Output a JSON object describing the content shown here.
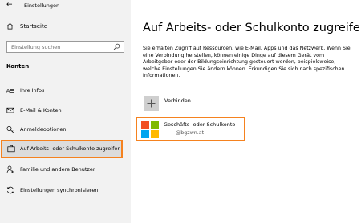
{
  "app": {
    "title": "Einstellungen",
    "back_icon": "arrow-left-icon"
  },
  "sidebar": {
    "home": {
      "label": "Startseite",
      "icon": "home-icon"
    },
    "search": {
      "placeholder": "Einstellung suchen",
      "icon": "search-icon"
    },
    "section_heading": "Konten",
    "items": [
      {
        "label": "Ihre Infos",
        "icon": "contact-card-icon",
        "selected": false
      },
      {
        "label": "E-Mail & Konten",
        "icon": "mail-icon",
        "selected": false
      },
      {
        "label": "Anmeldeoptionen",
        "icon": "key-icon",
        "selected": false
      },
      {
        "label": "Auf Arbeits- oder Schulkonto zugreifen",
        "icon": "briefcase-icon",
        "selected": true
      },
      {
        "label": "Familie und andere Benutzer",
        "icon": "person-add-icon",
        "selected": false
      },
      {
        "label": "Einstellungen synchronisieren",
        "icon": "sync-icon",
        "selected": false
      }
    ]
  },
  "main": {
    "title": "Auf Arbeits- oder Schulkonto zugreifen",
    "description": "Sie erhalten Zugriff auf Ressourcen, wie E-Mail, Apps und das Netzwerk. Wenn Sie eine Verbindung herstellen, können einige Dinge auf diesem Gerät vom Arbeitgeber oder der Bildungseinrichtung gesteuert werden, beispielsweise, welche Einstellungen Sie ändern können. Erkundigen Sie sich nach spezifischen Informationen.",
    "connect": {
      "label": "Verbinden",
      "icon": "plus-icon"
    },
    "account": {
      "name": "Geschäfts- oder Schulkonto",
      "email": "@bgzwn.at",
      "icon": "microsoft-logo-icon"
    }
  },
  "colors": {
    "highlight": "#f5821f",
    "sidebar_bg": "#f2f2f2",
    "selected_bg": "#dcdcdc",
    "ms_red": "#f25022",
    "ms_green": "#7fba00",
    "ms_blue": "#00a4ef",
    "ms_yellow": "#ffb900"
  }
}
